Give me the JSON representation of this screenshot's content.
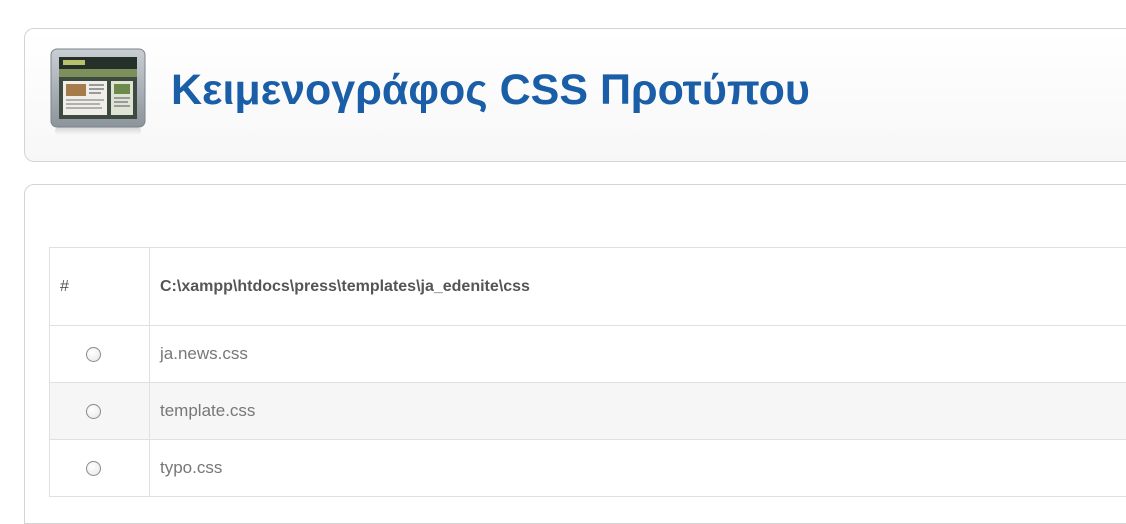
{
  "header": {
    "title": "Κειμενογράφος CSS Προτύπου",
    "icon": "template-preview-icon"
  },
  "table": {
    "hash_header": "#",
    "path_header": "C:\\xampp\\htdocs\\press\\templates\\ja_edenite\\css",
    "rows": [
      {
        "file": "ja.news.css",
        "selected": false
      },
      {
        "file": "template.css",
        "selected": false
      },
      {
        "file": "typo.css",
        "selected": false
      }
    ]
  },
  "colors": {
    "title": "#1a5ea8",
    "border": "#d4d4d4",
    "row_alt": "#f6f6f6"
  }
}
